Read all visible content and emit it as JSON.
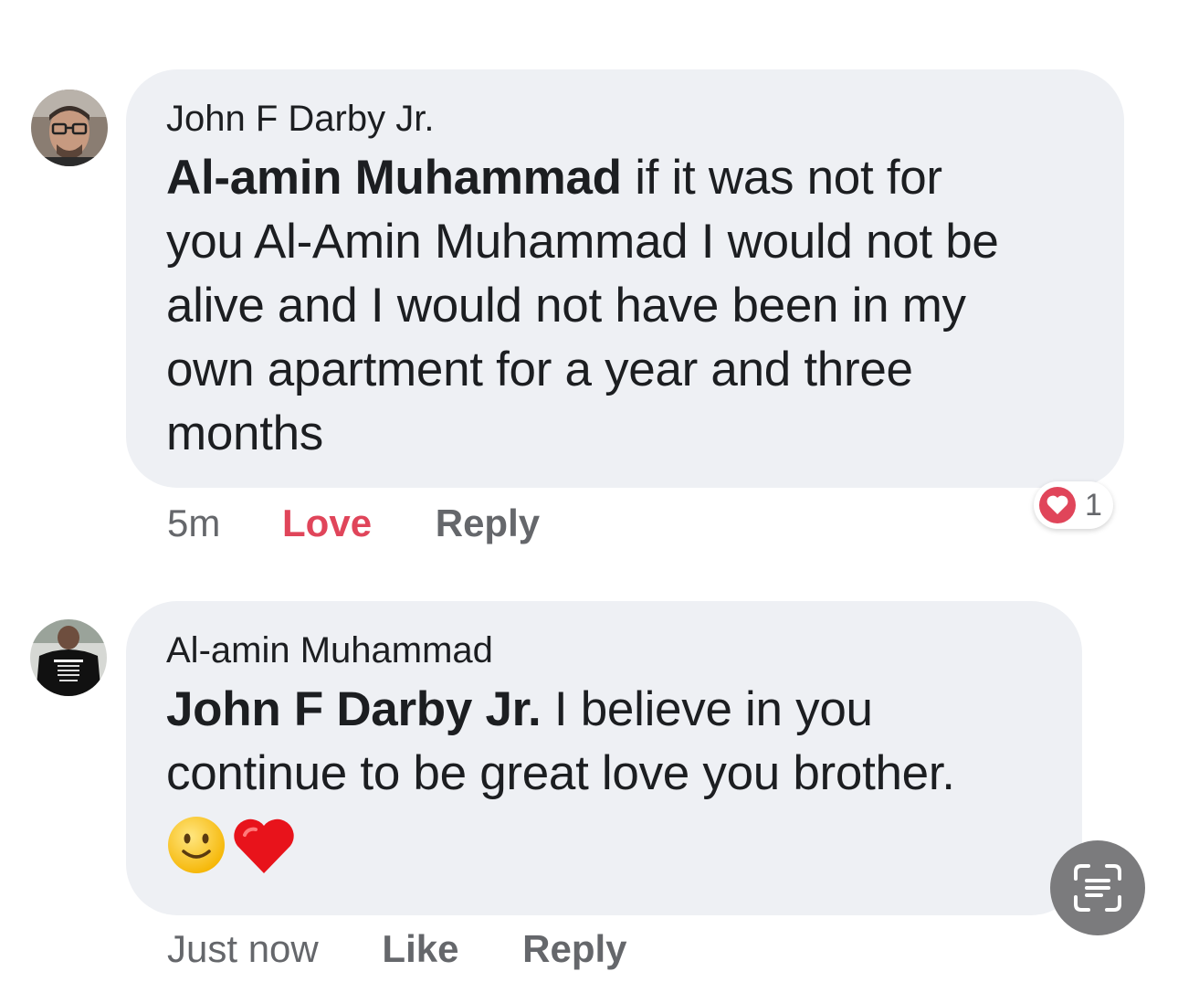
{
  "comments": [
    {
      "author": "John F Darby Jr.",
      "mention": "Al-amin Muhammad",
      "text_lines": [
        " if it was not for",
        "you Al-Amin Muhammad I would not be",
        "alive and I would not have been in my",
        "own apartment for a year and three",
        "months"
      ],
      "time": "5m",
      "reaction_label": "Love",
      "reply_label": "Reply",
      "reaction_count": "1",
      "reaction_icon": "heart-icon",
      "avatar": "man-with-glasses-avatar"
    },
    {
      "author": "Al-amin Muhammad",
      "mention": "John F Darby Jr.",
      "text_lines": [
        " I believe in you",
        "continue to be great love you brother."
      ],
      "emojis": [
        "slightly-smiling-face-icon",
        "red-heart-icon"
      ],
      "time": "Just now",
      "reaction_label": "Like",
      "reply_label": "Reply",
      "avatar": "man-in-black-shirt-avatar"
    }
  ],
  "overlay": {
    "icon": "text-scan-icon"
  },
  "colors": {
    "bubble": "#eef0f4",
    "love": "#e0455a",
    "meta": "#65676b",
    "scan_button": "#7b7b7d"
  }
}
